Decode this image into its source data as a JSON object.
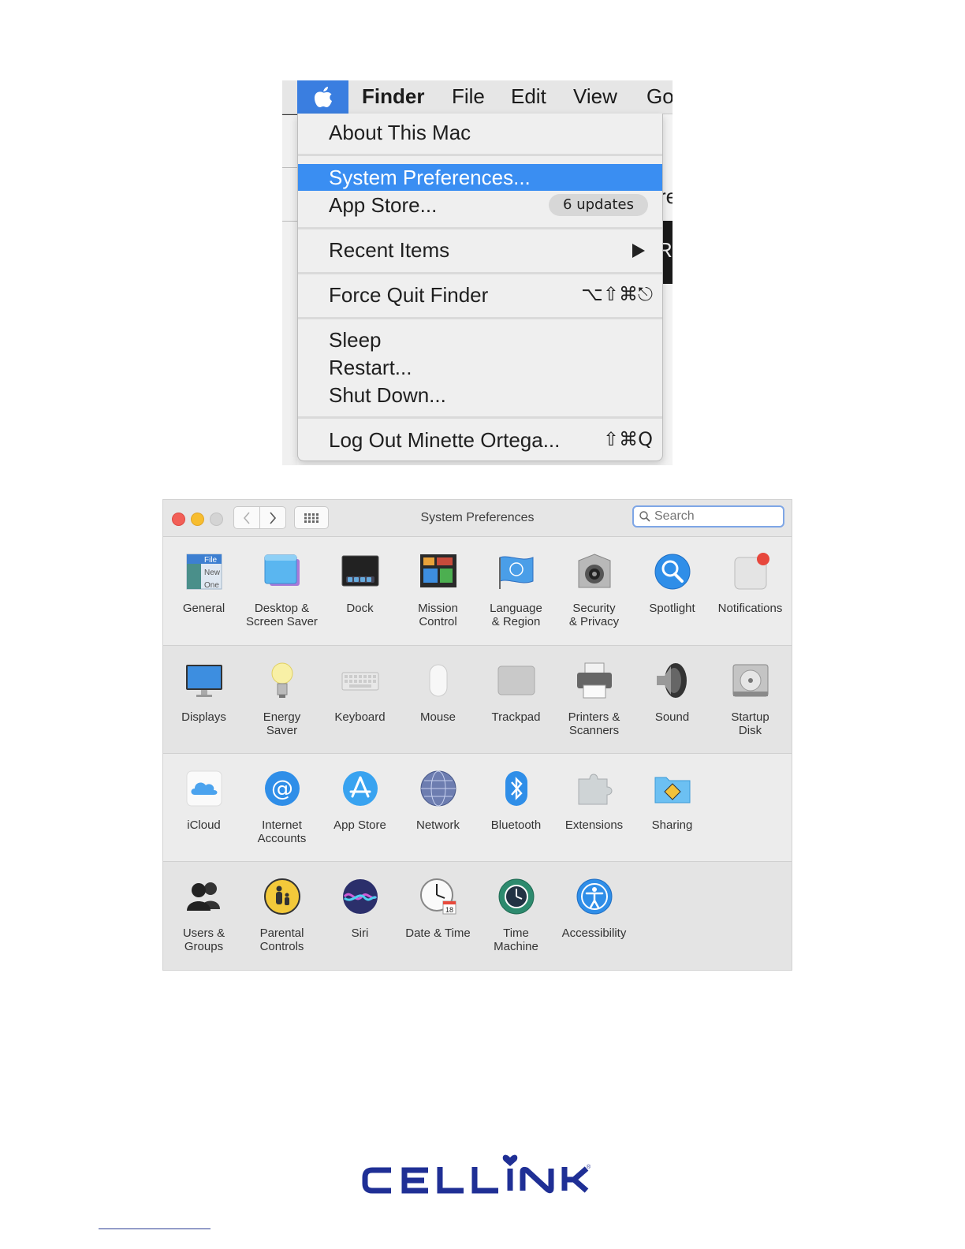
{
  "menubar": {
    "items": [
      "Finder",
      "File",
      "Edit",
      "View",
      "Go"
    ]
  },
  "apple_menu": {
    "about": "About This Mac",
    "system_preferences": "System Preferences...",
    "app_store": "App Store...",
    "app_store_badge": "6 updates",
    "recent_items": "Recent Items",
    "force_quit": "Force Quit Finder",
    "force_quit_shortcut": "⌥⇧⌘⎋",
    "sleep": "Sleep",
    "restart": "Restart...",
    "shut_down": "Shut Down...",
    "log_out": "Log Out Minette Ortega...",
    "log_out_shortcut": "⇧⌘Q"
  },
  "bg_fragments": {
    "frag1": "re",
    "frag2": "Re"
  },
  "syspref": {
    "title": "System Preferences",
    "search_placeholder": "Search",
    "row1": [
      {
        "label": "General",
        "icon": "general-icon"
      },
      {
        "label": "Desktop &\nScreen Saver",
        "icon": "desktop-icon"
      },
      {
        "label": "Dock",
        "icon": "dock-icon"
      },
      {
        "label": "Mission\nControl",
        "icon": "mission-control-icon"
      },
      {
        "label": "Language\n& Region",
        "icon": "flag-icon"
      },
      {
        "label": "Security\n& Privacy",
        "icon": "security-icon"
      },
      {
        "label": "Spotlight",
        "icon": "spotlight-icon"
      },
      {
        "label": "Notifications",
        "icon": "notifications-icon"
      }
    ],
    "row2": [
      {
        "label": "Displays",
        "icon": "display-icon"
      },
      {
        "label": "Energy\nSaver",
        "icon": "lightbulb-icon"
      },
      {
        "label": "Keyboard",
        "icon": "keyboard-icon"
      },
      {
        "label": "Mouse",
        "icon": "mouse-icon"
      },
      {
        "label": "Trackpad",
        "icon": "trackpad-icon"
      },
      {
        "label": "Printers &\nScanners",
        "icon": "printer-icon"
      },
      {
        "label": "Sound",
        "icon": "speaker-icon"
      },
      {
        "label": "Startup\nDisk",
        "icon": "disk-icon"
      }
    ],
    "row3": [
      {
        "label": "iCloud",
        "icon": "icloud-icon"
      },
      {
        "label": "Internet\nAccounts",
        "icon": "at-sign-icon"
      },
      {
        "label": "App Store",
        "icon": "app-store-icon"
      },
      {
        "label": "Network",
        "icon": "globe-icon"
      },
      {
        "label": "Bluetooth",
        "icon": "bluetooth-icon"
      },
      {
        "label": "Extensions",
        "icon": "puzzle-icon"
      },
      {
        "label": "Sharing",
        "icon": "sharing-folder-icon"
      }
    ],
    "row4": [
      {
        "label": "Users &\nGroups",
        "icon": "users-icon"
      },
      {
        "label": "Parental\nControls",
        "icon": "parental-icon"
      },
      {
        "label": "Siri",
        "icon": "siri-icon"
      },
      {
        "label": "Date & Time",
        "icon": "clock-calendar-icon"
      },
      {
        "label": "Time\nMachine",
        "icon": "time-machine-icon"
      },
      {
        "label": "Accessibility",
        "icon": "accessibility-icon"
      }
    ]
  },
  "general_icon_text": [
    "File",
    "New",
    "One"
  ],
  "date_icon_number": "18",
  "logo_text": "CELLINK",
  "colors": {
    "menu_highlight": "#3a8ef2",
    "apple_tab": "#3a7ee0",
    "logo_blue": "#1f2f95"
  }
}
